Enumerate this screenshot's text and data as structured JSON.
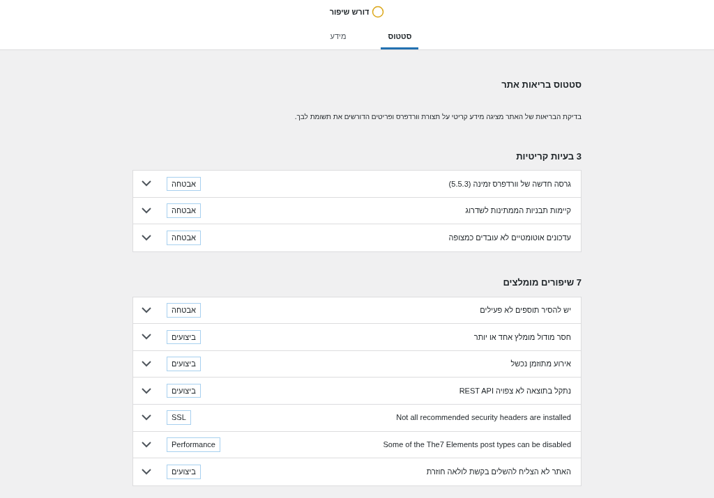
{
  "header": {
    "status_label": "דורש שיפור",
    "tabs": [
      {
        "label": "סטטוס",
        "selected": true
      },
      {
        "label": "מידע",
        "selected": false
      }
    ]
  },
  "title": "סטטוס בריאות אתר",
  "description": "בדיקת הבריאות של האתר מציגה מידע קריטי על תצורת וורדפרס ופריטים הדורשים את תשומת לבך.",
  "sections": [
    {
      "heading": "3 בעיות קריטיות",
      "items": [
        {
          "label": "גרסה חדשה של וורדפרס זמינה (5.5.3)",
          "badge": "אבטחה",
          "expanded": false
        },
        {
          "label": "קיימות תבניות הממתינות לשדרוג",
          "badge": "אבטחה",
          "expanded": false
        },
        {
          "label": "עדכונים אוטומטיים לא עובדים כמצופה",
          "badge": "אבטחה",
          "expanded": false
        }
      ]
    },
    {
      "heading": "7 שיפורים מומלצים",
      "items": [
        {
          "label": "יש להסיר תוספים לא פעילים",
          "badge": "אבטחה",
          "expanded": false
        },
        {
          "label": "חסר מודול מומלץ אחד או יותר",
          "badge": "ביצועים",
          "expanded": false
        },
        {
          "label": "אירוע מתוזמן נכשל",
          "badge": "ביצועים",
          "expanded": false
        },
        {
          "label": "REST API נתקל בתוצאה לא צפויה",
          "badge": "ביצועים",
          "expanded": false
        },
        {
          "label": "Not all recommended security headers are installed",
          "badge": "SSL",
          "expanded": false
        },
        {
          "label": "Some of the The7 Elements post types can be disabled",
          "badge": "Performance",
          "expanded": false
        },
        {
          "label": "האתר לא הצליח להשלים בקשת לולאה חוזרת",
          "badge": "ביצועים",
          "expanded": false
        }
      ]
    }
  ]
}
